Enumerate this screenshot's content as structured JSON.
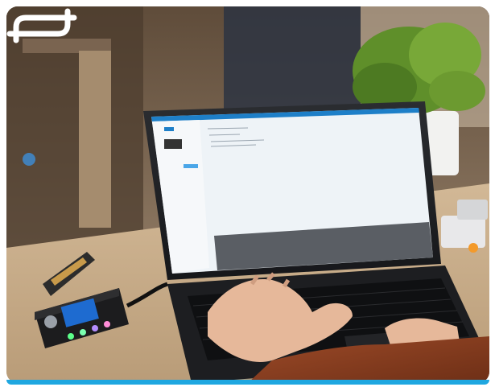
{
  "scene": {
    "description_icons": [
      "laptop-icon",
      "microcontroller-icon",
      "plant-icon",
      "hands-icon"
    ]
  },
  "colors": {
    "accent": "#1fa7e0",
    "screen_header": "#1e7fc8",
    "frame_corner": "#ffffff"
  }
}
